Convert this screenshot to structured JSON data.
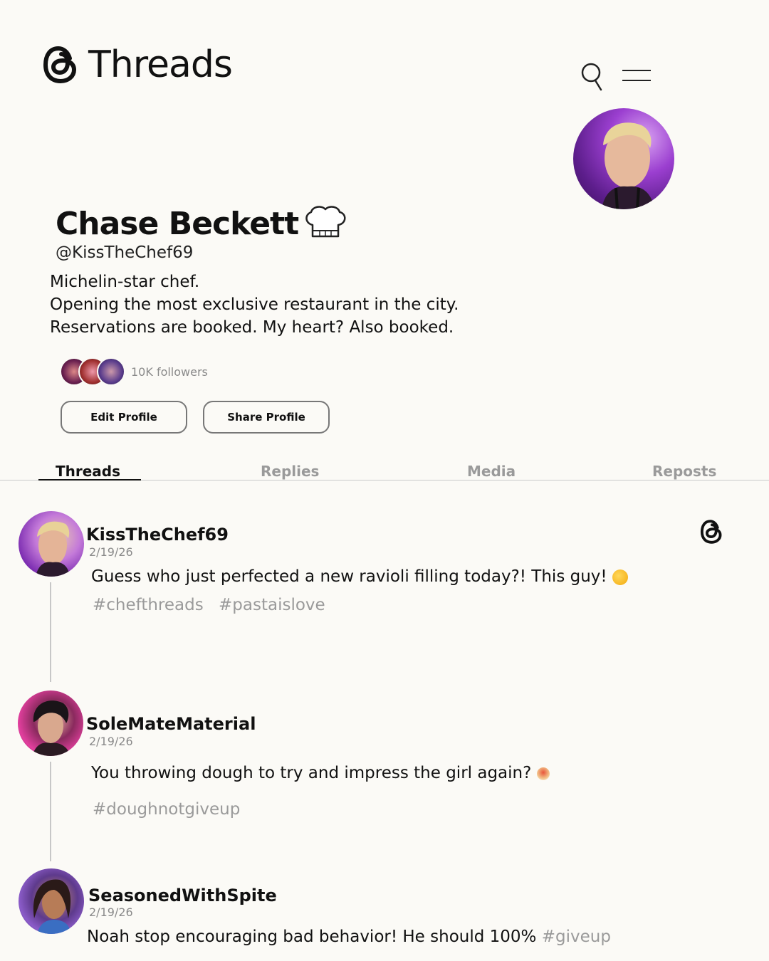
{
  "header": {
    "brand_name": "Threads"
  },
  "profile": {
    "display_name": "Chase Beckett",
    "handle": "@KissTheChef69",
    "bio_lines": [
      "Michelin-star chef.",
      "Opening the most exclusive restaurant in the city.",
      "Reservations are booked. My heart? Also booked."
    ],
    "followers_text": "10K followers",
    "edit_label": "Edit Profile",
    "share_label": "Share Profile"
  },
  "tabs": [
    {
      "label": "Threads",
      "active": true
    },
    {
      "label": "Replies",
      "active": false
    },
    {
      "label": "Media",
      "active": false
    },
    {
      "label": "Reposts",
      "active": false
    }
  ],
  "posts": [
    {
      "username": "KissTheChef69",
      "date": "2/19/26",
      "text": "Guess who just perfected a new ravioli filling today?! This guy!",
      "tags": [
        "#chefthreads",
        "#pastaislove"
      ]
    },
    {
      "username": "SoleMateMaterial",
      "date": "2/19/26",
      "text": "You throwing dough to try and impress the girl again?",
      "tags": [
        "#doughnotgiveup"
      ]
    },
    {
      "username": "SeasonedWithSpite",
      "date": "2/19/26",
      "text": "Noah stop encouraging bad behavior! He should 100%",
      "tags": [
        "#giveup"
      ]
    }
  ],
  "colors": {
    "background": "#fbfaf6",
    "muted_text": "#9a9a9a",
    "accent_purple": "#9b3fd0"
  }
}
